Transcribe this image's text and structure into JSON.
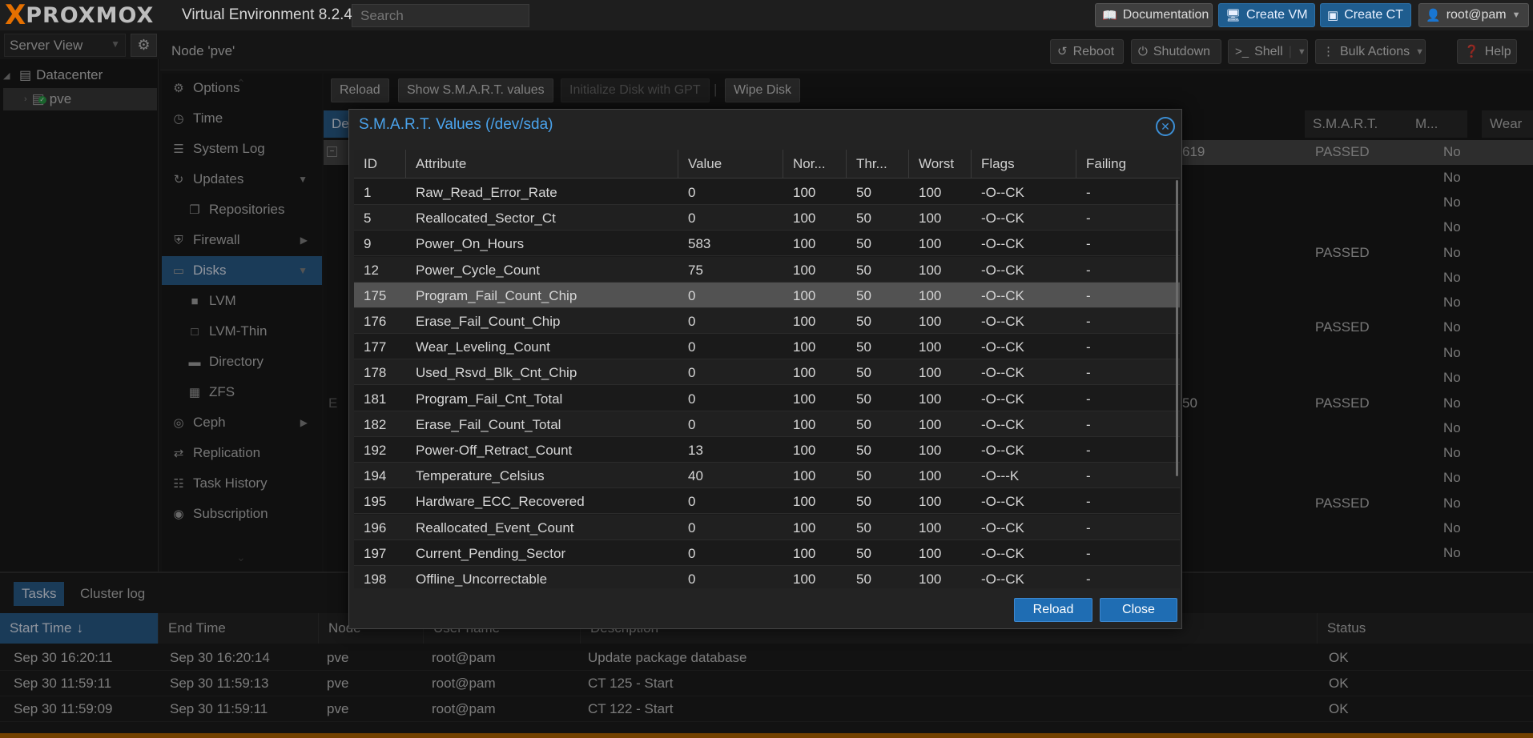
{
  "topbar": {
    "logo_x": "X",
    "logo_text": "PROXMOX",
    "version": "Virtual Environment 8.2.4",
    "search_placeholder": "Search",
    "documentation": "Documentation",
    "create_vm": "Create VM",
    "create_ct": "Create CT",
    "user": "root@pam"
  },
  "left": {
    "view": "Server View",
    "datacenter": "Datacenter",
    "node": "pve"
  },
  "node_header": {
    "title": "Node 'pve'",
    "reboot": "Reboot",
    "shutdown": "Shutdown",
    "shell": "Shell",
    "bulk_actions": "Bulk Actions",
    "help": "Help"
  },
  "nav": {
    "items": [
      {
        "label": "Options",
        "icon": "gear-icon"
      },
      {
        "label": "Time",
        "icon": "clock-icon"
      },
      {
        "label": "System Log",
        "icon": "list-icon"
      },
      {
        "label": "Updates",
        "icon": "refresh-icon"
      },
      {
        "label": "Repositories",
        "icon": "files-icon"
      },
      {
        "label": "Firewall",
        "icon": "shield-icon"
      },
      {
        "label": "Disks",
        "icon": "hdd-icon"
      },
      {
        "label": "LVM",
        "icon": "square-icon"
      },
      {
        "label": "LVM-Thin",
        "icon": "square-outline-icon"
      },
      {
        "label": "Directory",
        "icon": "folder-icon"
      },
      {
        "label": "ZFS",
        "icon": "grid-icon"
      },
      {
        "label": "Ceph",
        "icon": "ceph-icon"
      },
      {
        "label": "Replication",
        "icon": "retweet-icon"
      },
      {
        "label": "Task History",
        "icon": "list-alt-icon"
      },
      {
        "label": "Subscription",
        "icon": "support-icon"
      }
    ]
  },
  "disks": {
    "toolbar": {
      "reload": "Reload",
      "show_smart": "Show S.M.A.R.T. values",
      "init_gpt": "Initialize Disk with GPT",
      "wipe": "Wipe Disk"
    },
    "headers": {
      "device": "De",
      "smart": "S.M.A.R.T.",
      "mounted": "M...",
      "wear": "Wear"
    },
    "fragments": {
      "f619": "619",
      "f50": "50",
      "e": "E"
    },
    "rows": [
      {
        "smart": "PASSED",
        "mounted": "No"
      },
      {
        "smart": "",
        "mounted": "No"
      },
      {
        "smart": "",
        "mounted": "No"
      },
      {
        "smart": "",
        "mounted": "No"
      },
      {
        "smart": "PASSED",
        "mounted": "No"
      },
      {
        "smart": "",
        "mounted": "No"
      },
      {
        "smart": "",
        "mounted": "No"
      },
      {
        "smart": "PASSED",
        "mounted": "No"
      },
      {
        "smart": "",
        "mounted": "No"
      },
      {
        "smart": "",
        "mounted": "No"
      },
      {
        "smart": "PASSED",
        "mounted": "No"
      },
      {
        "smart": "",
        "mounted": "No"
      },
      {
        "smart": "",
        "mounted": "No"
      },
      {
        "smart": "",
        "mounted": "No"
      },
      {
        "smart": "PASSED",
        "mounted": "No"
      },
      {
        "smart": "",
        "mounted": "No"
      },
      {
        "smart": "",
        "mounted": "No"
      }
    ]
  },
  "bottom": {
    "tabs": [
      "Tasks",
      "Cluster log"
    ],
    "headers": {
      "start": "Start Time",
      "end": "End Time",
      "node": "Node",
      "user": "User name",
      "desc": "Description",
      "status": "Status"
    },
    "rows": [
      {
        "start": "Sep 30 16:20:11",
        "end": "Sep 30 16:20:14",
        "node": "pve",
        "user": "root@pam",
        "desc": "Update package database",
        "status": "OK"
      },
      {
        "start": "Sep 30 11:59:11",
        "end": "Sep 30 11:59:13",
        "node": "pve",
        "user": "root@pam",
        "desc": "CT 125 - Start",
        "status": "OK"
      },
      {
        "start": "Sep 30 11:59:09",
        "end": "Sep 30 11:59:11",
        "node": "pve",
        "user": "root@pam",
        "desc": "CT 122 - Start",
        "status": "OK"
      }
    ]
  },
  "modal": {
    "title": "S.M.A.R.T. Values (/dev/sda)",
    "columns": {
      "id": "ID",
      "attribute": "Attribute",
      "value": "Value",
      "normalized": "Nor...",
      "threshold": "Thr...",
      "worst": "Worst",
      "flags": "Flags",
      "failing": "Failing"
    },
    "rows": [
      {
        "id": "1",
        "attribute": "Raw_Read_Error_Rate",
        "value": "0",
        "normalized": "100",
        "threshold": "50",
        "worst": "100",
        "flags": "-O--CK",
        "failing": "-"
      },
      {
        "id": "5",
        "attribute": "Reallocated_Sector_Ct",
        "value": "0",
        "normalized": "100",
        "threshold": "50",
        "worst": "100",
        "flags": "-O--CK",
        "failing": "-"
      },
      {
        "id": "9",
        "attribute": "Power_On_Hours",
        "value": "583",
        "normalized": "100",
        "threshold": "50",
        "worst": "100",
        "flags": "-O--CK",
        "failing": "-"
      },
      {
        "id": "12",
        "attribute": "Power_Cycle_Count",
        "value": "75",
        "normalized": "100",
        "threshold": "50",
        "worst": "100",
        "flags": "-O--CK",
        "failing": "-"
      },
      {
        "id": "175",
        "attribute": "Program_Fail_Count_Chip",
        "value": "0",
        "normalized": "100",
        "threshold": "50",
        "worst": "100",
        "flags": "-O--CK",
        "failing": "-"
      },
      {
        "id": "176",
        "attribute": "Erase_Fail_Count_Chip",
        "value": "0",
        "normalized": "100",
        "threshold": "50",
        "worst": "100",
        "flags": "-O--CK",
        "failing": "-"
      },
      {
        "id": "177",
        "attribute": "Wear_Leveling_Count",
        "value": "0",
        "normalized": "100",
        "threshold": "50",
        "worst": "100",
        "flags": "-O--CK",
        "failing": "-"
      },
      {
        "id": "178",
        "attribute": "Used_Rsvd_Blk_Cnt_Chip",
        "value": "0",
        "normalized": "100",
        "threshold": "50",
        "worst": "100",
        "flags": "-O--CK",
        "failing": "-"
      },
      {
        "id": "181",
        "attribute": "Program_Fail_Cnt_Total",
        "value": "0",
        "normalized": "100",
        "threshold": "50",
        "worst": "100",
        "flags": "-O--CK",
        "failing": "-"
      },
      {
        "id": "182",
        "attribute": "Erase_Fail_Count_Total",
        "value": "0",
        "normalized": "100",
        "threshold": "50",
        "worst": "100",
        "flags": "-O--CK",
        "failing": "-"
      },
      {
        "id": "192",
        "attribute": "Power-Off_Retract_Count",
        "value": "13",
        "normalized": "100",
        "threshold": "50",
        "worst": "100",
        "flags": "-O--CK",
        "failing": "-"
      },
      {
        "id": "194",
        "attribute": "Temperature_Celsius",
        "value": "40",
        "normalized": "100",
        "threshold": "50",
        "worst": "100",
        "flags": "-O---K",
        "failing": "-"
      },
      {
        "id": "195",
        "attribute": "Hardware_ECC_Recovered",
        "value": "0",
        "normalized": "100",
        "threshold": "50",
        "worst": "100",
        "flags": "-O--CK",
        "failing": "-"
      },
      {
        "id": "196",
        "attribute": "Reallocated_Event_Count",
        "value": "0",
        "normalized": "100",
        "threshold": "50",
        "worst": "100",
        "flags": "-O--CK",
        "failing": "-"
      },
      {
        "id": "197",
        "attribute": "Current_Pending_Sector",
        "value": "0",
        "normalized": "100",
        "threshold": "50",
        "worst": "100",
        "flags": "-O--CK",
        "failing": "-"
      },
      {
        "id": "198",
        "attribute": "Offline_Uncorrectable",
        "value": "0",
        "normalized": "100",
        "threshold": "50",
        "worst": "100",
        "flags": "-O--CK",
        "failing": "-"
      }
    ],
    "reload": "Reload",
    "close": "Close"
  }
}
